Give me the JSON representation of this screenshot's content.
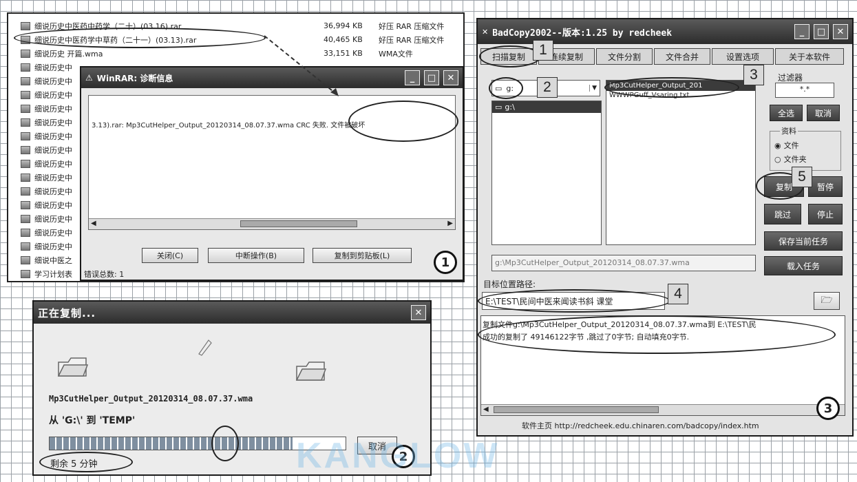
{
  "winrar_list": {
    "rows": [
      {
        "name": "细说历史中医药中药学（二十）(03.16).rar",
        "size": "36,994 KB",
        "type": "好压 RAR 压缩文件"
      },
      {
        "name": "细说历史中医药学中草药（二十一）(03.13).rar",
        "size": "40,465 KB",
        "type": "好压 RAR 压缩文件"
      },
      {
        "name": "细说历史 开篇.wma",
        "size": "33,151 KB",
        "type": "WMA文件"
      },
      {
        "name": "细说历史中"
      },
      {
        "name": "细说历史中"
      },
      {
        "name": "细说历史中"
      },
      {
        "name": "细说历史中"
      },
      {
        "name": "细说历史中"
      },
      {
        "name": "细说历史中"
      },
      {
        "name": "细说历史中"
      },
      {
        "name": "细说历史中"
      },
      {
        "name": "细说历史中"
      },
      {
        "name": "细说历史中"
      },
      {
        "name": "细说历史中"
      },
      {
        "name": "细说历史中"
      },
      {
        "name": "细说历史中"
      },
      {
        "name": "细说历史中"
      },
      {
        "name": "细说中医之"
      },
      {
        "name": "学习计划表"
      }
    ]
  },
  "winrar_dialog": {
    "title": "WinRAR: 诊断信息",
    "message": "3.13).rar: Mp3CutHelper_Output_20120314_08.07.37.wma CRC 失败. 文件被破坏",
    "btn_close": "关闭(C)",
    "btn_break": "中断操作(B)",
    "btn_copy": "复制到剪贴板(L)",
    "status": "错误总数: 1",
    "marker": "1"
  },
  "copy_dialog": {
    "title": "正在复制...",
    "filename": "Mp3CutHelper_Output_20120314_08.07.37.wma",
    "from_to": "从 'G:\\' 到 'TEMP'",
    "progress": 0.82,
    "remaining": "剩余 5 分钟",
    "cancel": "取消",
    "marker": "2"
  },
  "badcopy": {
    "title": "BadCopy2002--版本:1.25  by redcheek",
    "tabs": [
      "扫描复制",
      "连续复制",
      "文件分割",
      "文件合并",
      "设置选项",
      "关于本软件"
    ],
    "drive": "g:",
    "tree_item": "g:\\",
    "files": [
      "Mp3CutHelper_Output_201",
      "WWWPGuff_Vsaring.txt"
    ],
    "filter_label": "过滤器",
    "filter_value": "*.*",
    "btn_select_all": "全选",
    "btn_clear": "取消",
    "group_label": "资料",
    "radio_file": "文件",
    "radio_folder": "文件夹",
    "btn_copy": "复制",
    "btn_pause": "暂停",
    "btn_skip": "跳过",
    "btn_stop": "停止",
    "btn_save": "保存当前任务",
    "btn_load": "载入任务",
    "source_path": "g:\\Mp3CutHelper_Output_20120314_08.07.37.wma",
    "target_label": "目标位置路径:",
    "target_path": "E:\\TEST\\民间中医来闻读书斜 课堂",
    "log_line1": "复制文件g:\\Mp3CutHelper_Output_20120314_08.07.37.wma到 E:\\TEST\\民",
    "log_line2": "成功的复制了 49146122字节 ,跳过了0字节; 自动填充0字节.",
    "footer": "软件主页 http://redcheek.edu.chinaren.com/badcopy/index.htm",
    "markers": [
      "1",
      "2",
      "3",
      "4",
      "5",
      "3"
    ]
  },
  "watermark": "KANGLOW"
}
